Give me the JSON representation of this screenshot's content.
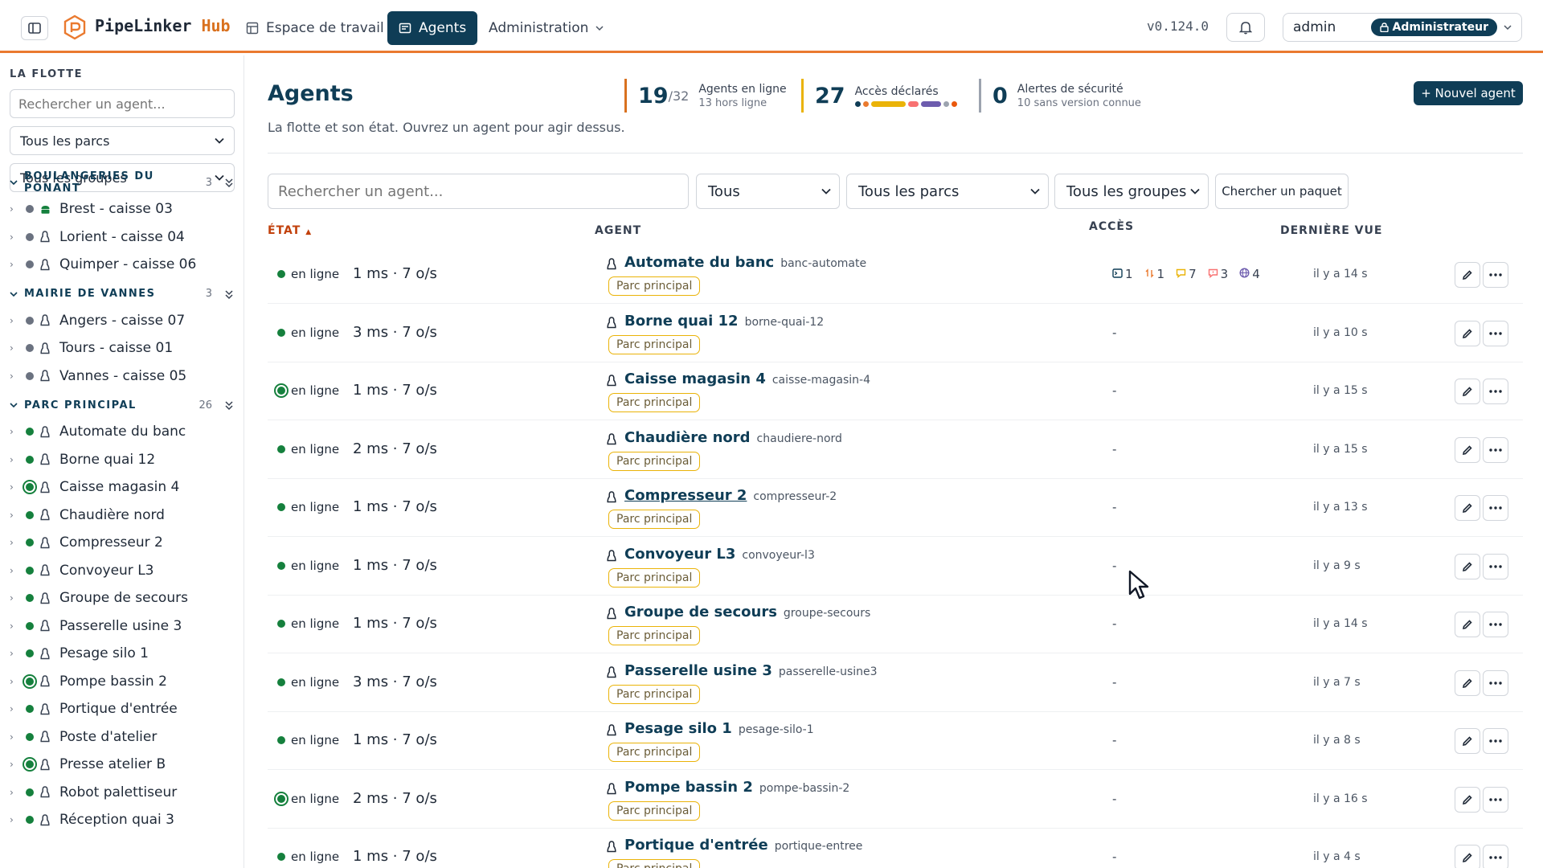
{
  "app": {
    "brand_name": "PipeLinker",
    "brand_suffix": "Hub",
    "version": "v0.124.0",
    "accent_color": "#ea7a2f",
    "primary_color": "#0f3d56"
  },
  "nav": {
    "workspace": "Espace de travail",
    "agents": "Agents",
    "administration": "Administration"
  },
  "user": {
    "name": "admin",
    "role": "Administrateur"
  },
  "sidebar": {
    "title": "LA FLOTTE",
    "search_placeholder": "Rechercher un agent...",
    "parks_select": "Tous les parcs",
    "groups_select": "Tous les groupes",
    "groups": [
      {
        "name": "BOULANGERIES DU PONANT",
        "count": "3",
        "items": [
          {
            "label": "Brest - caisse 03",
            "status": "gray",
            "os": "android-icon"
          },
          {
            "label": "Lorient - caisse 04",
            "status": "gray",
            "os": "linux-icon"
          },
          {
            "label": "Quimper - caisse 06",
            "status": "gray",
            "os": "linux-icon"
          }
        ]
      },
      {
        "name": "MAIRIE DE VANNES",
        "count": "3",
        "items": [
          {
            "label": "Angers - caisse 07",
            "status": "gray",
            "os": "linux-icon"
          },
          {
            "label": "Tours - caisse 01",
            "status": "gray",
            "os": "linux-icon"
          },
          {
            "label": "Vannes - caisse 05",
            "status": "gray",
            "os": "linux-icon"
          }
        ]
      },
      {
        "name": "PARC PRINCIPAL",
        "count": "26",
        "items": [
          {
            "label": "Automate du banc",
            "status": "green",
            "os": "linux-icon"
          },
          {
            "label": "Borne quai 12",
            "status": "green",
            "os": "linux-icon"
          },
          {
            "label": "Caisse magasin 4",
            "status": "ring",
            "os": "linux-icon"
          },
          {
            "label": "Chaudière nord",
            "status": "green",
            "os": "linux-icon"
          },
          {
            "label": "Compresseur 2",
            "status": "green",
            "os": "linux-icon"
          },
          {
            "label": "Convoyeur L3",
            "status": "green",
            "os": "linux-icon"
          },
          {
            "label": "Groupe de secours",
            "status": "green",
            "os": "linux-icon"
          },
          {
            "label": "Passerelle usine 3",
            "status": "green",
            "os": "linux-icon"
          },
          {
            "label": "Pesage silo 1",
            "status": "green",
            "os": "linux-icon"
          },
          {
            "label": "Pompe bassin 2",
            "status": "ring",
            "os": "linux-icon"
          },
          {
            "label": "Portique d'entrée",
            "status": "green",
            "os": "linux-icon"
          },
          {
            "label": "Poste d'atelier",
            "status": "green",
            "os": "linux-icon"
          },
          {
            "label": "Presse atelier B",
            "status": "ring",
            "os": "linux-icon"
          },
          {
            "label": "Robot palettiseur",
            "status": "green",
            "os": "linux-icon"
          },
          {
            "label": "Réception quai 3",
            "status": "green",
            "os": "linux-icon"
          }
        ]
      }
    ]
  },
  "main": {
    "title": "Agents",
    "subtitle": "La flotte et son état. Ouvrez un agent pour agir dessus.",
    "stats": {
      "online": {
        "value": "19",
        "total": "/32",
        "label": "Agents en ligne",
        "sub": "13 hors ligne"
      },
      "access": {
        "value": "27",
        "label": "Accès déclarés",
        "segments": [
          {
            "color": "#0f3d56",
            "share": 1
          },
          {
            "color": "#ea7a2f",
            "share": 1
          },
          {
            "color": "#eab308",
            "share": 7
          },
          {
            "color": "#f87171",
            "share": 2
          },
          {
            "color": "#6d5cae",
            "share": 4
          },
          {
            "color": "#9ca3af",
            "share": 1
          },
          {
            "color": "#ea580c",
            "share": 1
          }
        ]
      },
      "security": {
        "value": "0",
        "label": "Alertes de sécurité",
        "sub": "10 sans version connue"
      }
    },
    "new_agent_button": "+ Nouvel agent",
    "filters": {
      "search_placeholder": "Rechercher un agent...",
      "status": "Tous",
      "parks": "Tous les parcs",
      "groups": "Tous les groupes",
      "package_button": "Chercher un paquet"
    },
    "columns": {
      "state": "ÉTAT",
      "state_sort": "▲",
      "agent": "AGENT",
      "access": "ACCÈS",
      "last_seen": "DERNIÈRE VUE"
    },
    "rows": [
      {
        "status": "en ligne",
        "ring": false,
        "metrics": "1 ms · 7 o/s",
        "name": "Automate du banc",
        "slug": "banc-automate",
        "tag": "Parc principal",
        "access": "",
        "seen": "il y a 14 s",
        "access_items": [
          {
            "icon": "terminal-icon",
            "count": "1",
            "color": "#0f3d56"
          },
          {
            "icon": "transfer-icon",
            "count": "1",
            "color": "#ea7a2f"
          },
          {
            "icon": "chat-icon",
            "count": "7",
            "color": "#eab308"
          },
          {
            "icon": "chat-alert-icon",
            "count": "3",
            "color": "#f87171"
          },
          {
            "icon": "globe-icon",
            "count": "4",
            "color": "#6d5cae"
          }
        ]
      },
      {
        "status": "en ligne",
        "ring": false,
        "metrics": "3 ms · 7 o/s",
        "name": "Borne quai 12",
        "slug": "borne-quai-12",
        "tag": "Parc principal",
        "access": "-",
        "seen": "il y a 10 s"
      },
      {
        "status": "en ligne",
        "ring": true,
        "metrics": "1 ms · 7 o/s",
        "name": "Caisse magasin 4",
        "slug": "caisse-magasin-4",
        "tag": "Parc principal",
        "access": "-",
        "seen": "il y a 15 s"
      },
      {
        "status": "en ligne",
        "ring": false,
        "metrics": "2 ms · 7 o/s",
        "name": "Chaudière nord",
        "slug": "chaudiere-nord",
        "tag": "Parc principal",
        "access": "-",
        "seen": "il y a 15 s"
      },
      {
        "status": "en ligne",
        "ring": false,
        "metrics": "1 ms · 7 o/s",
        "name": "Compresseur 2",
        "slug": "compresseur-2",
        "tag": "Parc principal",
        "access": "-",
        "seen": "il y a 13 s",
        "hover": true
      },
      {
        "status": "en ligne",
        "ring": false,
        "metrics": "1 ms · 7 o/s",
        "name": "Convoyeur L3",
        "slug": "convoyeur-l3",
        "tag": "Parc principal",
        "access": "-",
        "seen": "il y a 9 s"
      },
      {
        "status": "en ligne",
        "ring": false,
        "metrics": "1 ms · 7 o/s",
        "name": "Groupe de secours",
        "slug": "groupe-secours",
        "tag": "Parc principal",
        "access": "-",
        "seen": "il y a 14 s"
      },
      {
        "status": "en ligne",
        "ring": false,
        "metrics": "3 ms · 7 o/s",
        "name": "Passerelle usine 3",
        "slug": "passerelle-usine3",
        "tag": "Parc principal",
        "access": "-",
        "seen": "il y a 7 s"
      },
      {
        "status": "en ligne",
        "ring": false,
        "metrics": "1 ms · 7 o/s",
        "name": "Pesage silo 1",
        "slug": "pesage-silo-1",
        "tag": "Parc principal",
        "access": "-",
        "seen": "il y a 8 s"
      },
      {
        "status": "en ligne",
        "ring": true,
        "metrics": "2 ms · 7 o/s",
        "name": "Pompe bassin 2",
        "slug": "pompe-bassin-2",
        "tag": "Parc principal",
        "access": "-",
        "seen": "il y a 16 s"
      },
      {
        "status": "en ligne",
        "ring": false,
        "metrics": "1 ms · 7 o/s",
        "name": "Portique d'entrée",
        "slug": "portique-entree",
        "tag": "Parc principal",
        "access": "-",
        "seen": "il y a 4 s"
      }
    ]
  }
}
